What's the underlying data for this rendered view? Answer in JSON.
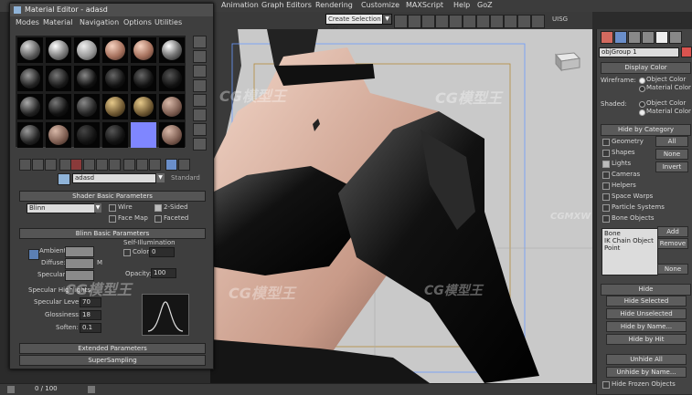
{
  "menubar": {
    "items": [
      "Animation",
      "Graph Editors",
      "Rendering",
      "Customize",
      "MAXScript",
      "Help",
      "GoZ"
    ],
    "selection_set": "Create Selection Set",
    "workspace": "UISG"
  },
  "material_editor": {
    "title": "Material Editor - adasd",
    "menu": [
      "Modes",
      "Material",
      "Navigation",
      "Options",
      "Utilities"
    ],
    "material_name": "adasd",
    "material_type": "Standard",
    "shader_rollout": "Shader Basic Parameters",
    "shader_type": "Blinn",
    "checkboxes": [
      {
        "label": "Wire",
        "checked": false
      },
      {
        "label": "2-Sided",
        "checked": true
      },
      {
        "label": "Face Map",
        "checked": false
      },
      {
        "label": "Faceted",
        "checked": false
      }
    ],
    "blinn_rollout": "Blinn Basic Parameters",
    "self_illum_label": "Self-Illumination",
    "color_label": "Color",
    "color_value": "0",
    "ambient_label": "Ambient:",
    "diffuse_label": "Diffuse:",
    "specular_label": "Specular:",
    "m_label": "M",
    "opacity_label": "Opacity:",
    "opacity_value": "100",
    "highlights_label": "Specular Highlights",
    "spec_level_label": "Specular Level:",
    "spec_level_value": "70",
    "glossiness_label": "Glossiness:",
    "glossiness_value": "18",
    "soften_label": "Soften:",
    "soften_value": "0.1",
    "extended_rollout": "Extended Parameters",
    "supersampling_rollout": "SuperSampling"
  },
  "command_panel": {
    "object_name": "objGroup 1",
    "display_color_head": "Display Color",
    "wireframe_label": "Wireframe:",
    "shaded_label": "Shaded:",
    "object_color": "Object Color",
    "material_color": "Material Color",
    "hide_by_category_head": "Hide by Category",
    "categories": [
      {
        "label": "Geometry",
        "checked": false
      },
      {
        "label": "Shapes",
        "checked": false
      },
      {
        "label": "Lights",
        "checked": true
      },
      {
        "label": "Cameras",
        "checked": false
      },
      {
        "label": "Helpers",
        "checked": false
      },
      {
        "label": "Space Warps",
        "checked": false
      },
      {
        "label": "Particle Systems",
        "checked": false
      },
      {
        "label": "Bone Objects",
        "checked": false
      }
    ],
    "all_btn": "All",
    "none_btn": "None",
    "invert_btn": "Invert",
    "list_items": [
      "Bone",
      "IK Chain Object",
      "Point"
    ],
    "add_btn": "Add",
    "remove_btn": "Remove",
    "none_btn2": "None",
    "hide_head": "Hide",
    "hide_buttons": [
      "Hide Selected",
      "Hide Unselected",
      "Hide by Name...",
      "Hide by Hit",
      "Unhide All",
      "Unhide by Name...",
      "Hide Frozen Objects"
    ]
  },
  "statusbar": {
    "frame": "0 / 100"
  },
  "watermarks": [
    "CG模型王",
    "CG模型王",
    "CG模型王",
    "CGMXW"
  ],
  "colors": {
    "accent_red": "#d9534f",
    "slot_highlight": "#7f86ff"
  }
}
